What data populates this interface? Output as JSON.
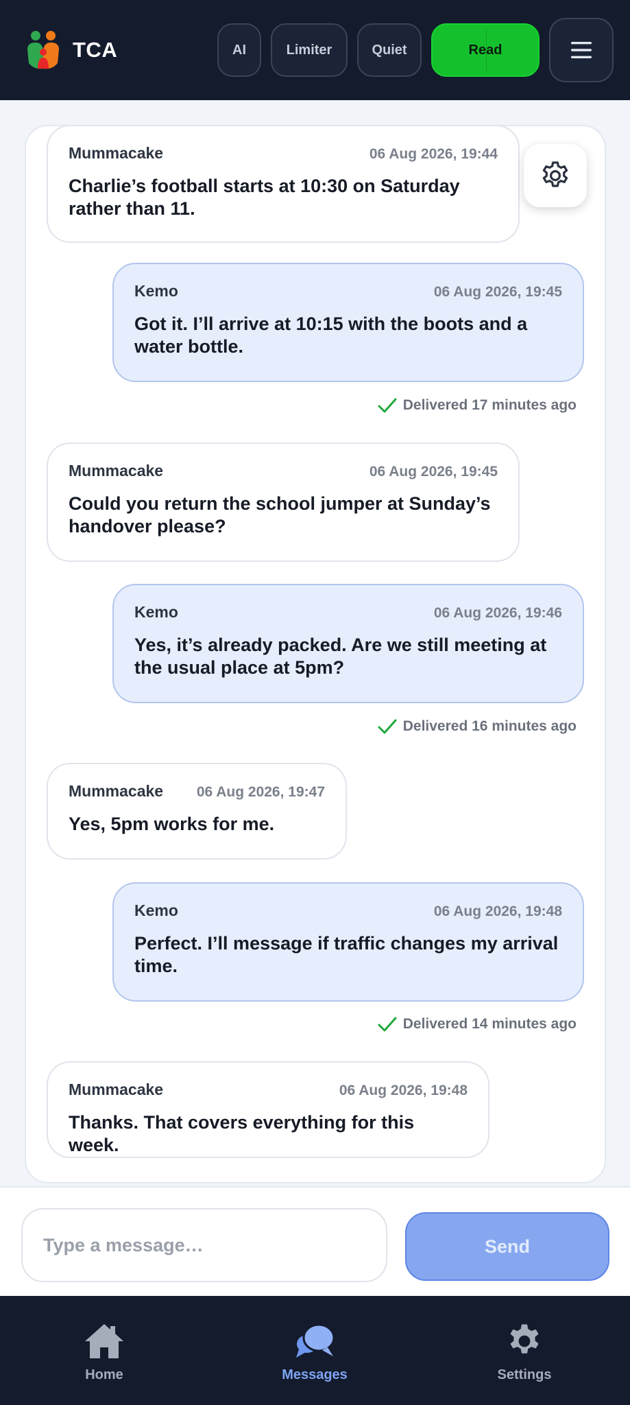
{
  "header": {
    "app_name": "TCA",
    "pills": {
      "ai": "AI",
      "limiter": "Limiter",
      "quiet": "Quiet",
      "read": "Read"
    },
    "menu_icon": "hamburger-menu-icon",
    "accent_read": "#14c12c"
  },
  "messages": [
    {
      "sender": "Mummacake",
      "time": "06 Aug 2026, 19:44",
      "text": "Charlie’s football starts at 10:30 on Saturday rather than 11.",
      "side": "them"
    },
    {
      "sender": "Kemo",
      "time": "06 Aug 2026, 19:45",
      "text": "Got it. I’ll arrive at 10:15 with the boots and a water bottle.",
      "side": "me",
      "status": "Delivered 17 minutes ago"
    },
    {
      "sender": "Mummacake",
      "time": "06 Aug 2026, 19:45",
      "text": "Could you return the school jumper at Sunday’s handover please?",
      "side": "them"
    },
    {
      "sender": "Kemo",
      "time": "06 Aug 2026, 19:46",
      "text": "Yes, it’s already packed. Are we still meeting at the usual place at 5pm?",
      "side": "me",
      "status": "Delivered 16 minutes ago"
    },
    {
      "sender": "Mummacake",
      "time": "06 Aug 2026, 19:47",
      "text": "Yes, 5pm works for me.",
      "side": "them"
    },
    {
      "sender": "Kemo",
      "time": "06 Aug 2026, 19:48",
      "text": "Perfect. I’ll message if traffic changes my arrival time.",
      "side": "me",
      "status": "Delivered 14 minutes ago"
    },
    {
      "sender": "Mummacake",
      "time": "06 Aug 2026, 19:48",
      "text": "Thanks. That covers everything for this week.",
      "side": "them"
    }
  ],
  "composer": {
    "placeholder": "Type a message…",
    "value": "",
    "send_label": "Send"
  },
  "nav": {
    "items": [
      {
        "label": "Home",
        "icon": "home-icon",
        "active": false
      },
      {
        "label": "Messages",
        "icon": "chat-bubbles-icon",
        "active": true
      },
      {
        "label": "Settings",
        "icon": "gear-icon",
        "active": false
      }
    ]
  }
}
